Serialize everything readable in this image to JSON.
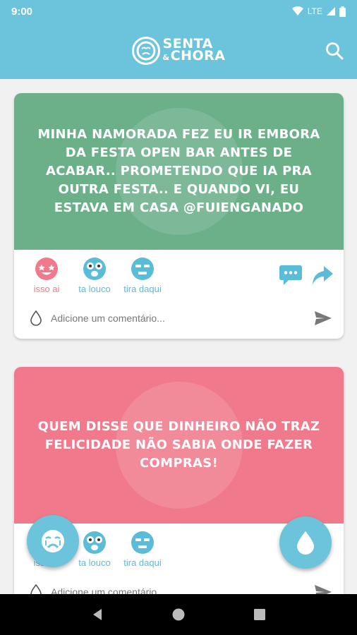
{
  "status_bar": {
    "time": "9:00",
    "network": "LTE"
  },
  "app": {
    "logo_line1": "SENTA",
    "logo_amp": "&",
    "logo_line2": "CHORA"
  },
  "posts": [
    {
      "text": "MINHA NAMORADA FEZ EU IR EMBORA DA FESTA OPEN BAR ANTES DE ACABAR.. PROMETENDO QUE IA PRA OUTRA FESTA.. E QUANDO VI, EU ESTAVA EM CASA @FUIENGANADO",
      "banner_color": "#6cb08a",
      "reactions": [
        {
          "label": "isso ai"
        },
        {
          "label": "ta louco"
        },
        {
          "label": "tira daqui"
        }
      ],
      "comment_placeholder": "Adicione um comentário..."
    },
    {
      "text": "QUEM DISSE QUE DINHEIRO NÃO TRAZ FELICIDADE NÃO SABIA ONDE FAZER COMPRAS!",
      "banner_color": "#f07a8b",
      "reactions": [
        {
          "label": "isso ai"
        },
        {
          "label": "ta louco"
        },
        {
          "label": "tira daqui"
        }
      ],
      "comment_placeholder": "Adicione um comentário..."
    }
  ],
  "colors": {
    "accent": "#6cc4dc",
    "pink": "#f07a8b",
    "green": "#6cb08a"
  },
  "icons": [
    "search-icon",
    "crying-face-icon",
    "drop-icon",
    "send-icon",
    "share-icon",
    "comment-icon"
  ]
}
